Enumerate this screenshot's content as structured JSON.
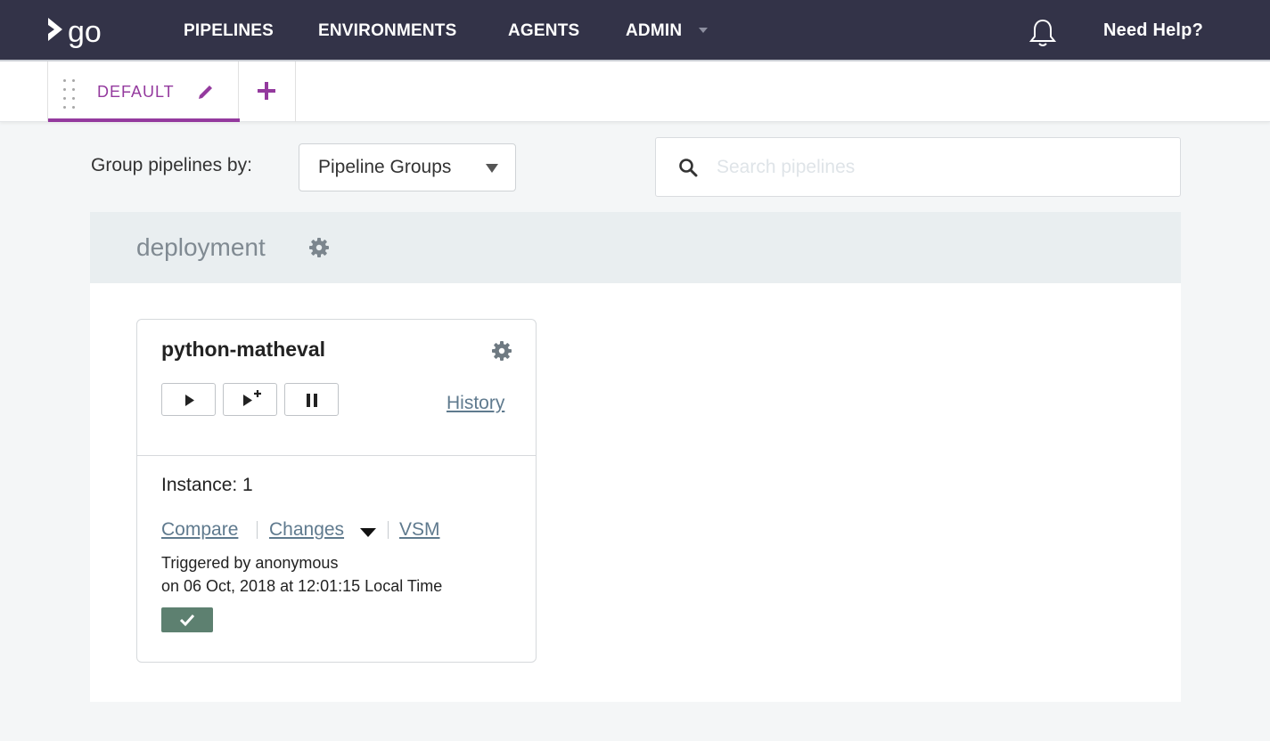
{
  "header": {
    "logo_text": "go",
    "nav": [
      {
        "label": "PIPELINES"
      },
      {
        "label": "ENVIRONMENTS"
      },
      {
        "label": "AGENTS"
      },
      {
        "label": "ADMIN"
      }
    ],
    "help_label": "Need Help?",
    "icons": {
      "bell": "bell-icon",
      "admin_caret": "chevron-down-icon"
    }
  },
  "tabs": {
    "active_label": "DEFAULT",
    "icons": {
      "drag": "drag-handle-icon",
      "edit": "pencil-icon",
      "add": "plus-icon"
    }
  },
  "filter": {
    "group_by_label": "Group pipelines by:",
    "group_by_value": "Pipeline Groups",
    "search_placeholder": "Search pipelines"
  },
  "group": {
    "name": "deployment",
    "icon": "gear-icon"
  },
  "pipeline": {
    "name": "python-matheval",
    "controls": [
      "play-icon",
      "play-with-options-icon",
      "pause-icon"
    ],
    "history_label": "History",
    "instance_label": "Instance: 1",
    "compare_label": "Compare",
    "changes_label": "Changes",
    "vsm_label": "VSM",
    "triggered_by": "Triggered by anonymous",
    "triggered_on": "on 06 Oct, 2018 at 12:01:15 Local Time",
    "stage_status": "passed"
  },
  "colors": {
    "nav_bg": "#333348",
    "accent": "#943a9e",
    "link": "#5f7a8e",
    "stage_passed": "#5d8070",
    "group_header_bg": "#e9eef0"
  }
}
